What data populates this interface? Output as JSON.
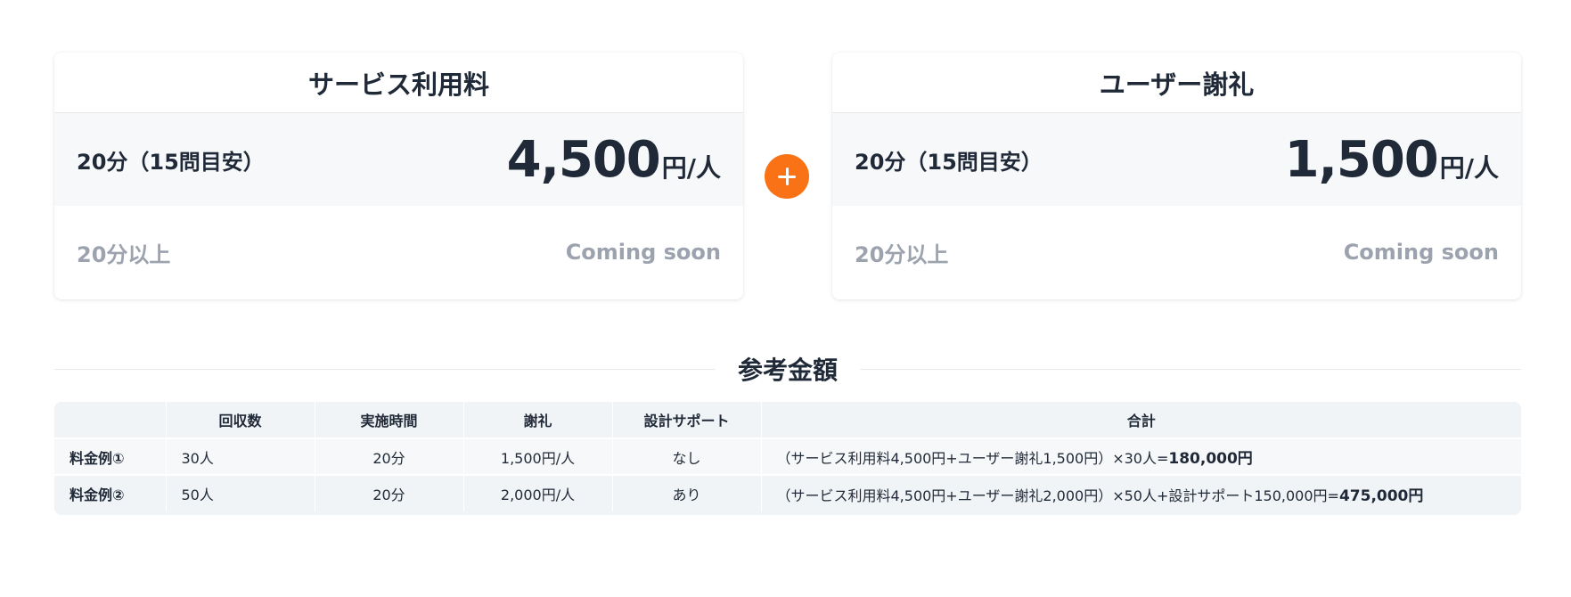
{
  "cards": [
    {
      "title": "サービス利用料",
      "primary_label": "20分（15問目安）",
      "price": "4,500",
      "unit": "円/人",
      "secondary_label": "20分以上",
      "secondary_value": "Coming soon"
    },
    {
      "title": "ユーザー謝礼",
      "primary_label": "20分（15問目安）",
      "price": "1,500",
      "unit": "円/人",
      "secondary_label": "20分以上",
      "secondary_value": "Coming soon"
    }
  ],
  "plus_icon": "plus-icon",
  "accent_color": "#f97316",
  "section_title": "参考金額",
  "table": {
    "headers": [
      "",
      "回収数",
      "実施時間",
      "謝礼",
      "設計サポート",
      "合計"
    ],
    "rows": [
      {
        "label": "料金例①",
        "count": "30人",
        "time": "20分",
        "reward": "1,500円/人",
        "support": "なし",
        "formula": "（サービス利用料4,500円+ユーザー謝礼1,500円）×30人=",
        "total": "180,000円"
      },
      {
        "label": "料金例②",
        "count": "50人",
        "time": "20分",
        "reward": "2,000円/人",
        "support": "あり",
        "formula": "（サービス利用料4,500円+ユーザー謝礼2,000円）×50人+設計サポート150,000円=",
        "total": "475,000円"
      }
    ]
  }
}
